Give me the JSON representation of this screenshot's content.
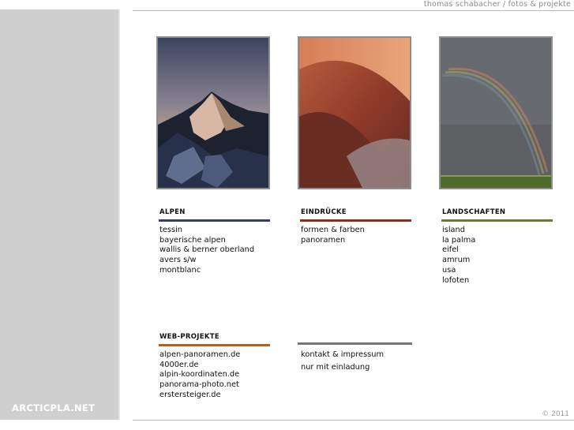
{
  "header": {
    "tagline": "thomas schabacher / fotos & projekte"
  },
  "footer": {
    "copyright": "© 2011"
  },
  "sidebar": {
    "brand": "ARCTICPLA.NET"
  },
  "sections": {
    "alpen": {
      "title": "ALPEN",
      "color": "#3a3f5a",
      "items": [
        "tessin",
        "bayerische alpen",
        "wallis & berner oberland",
        "avers s/w",
        "montblanc"
      ]
    },
    "eindruecke": {
      "title": "EINDRÜCKE",
      "color": "#8a2f20",
      "items": [
        "formen & farben",
        "panoramen"
      ]
    },
    "landschaften": {
      "title": "LANDSCHAFTEN",
      "color": "#6b7a3a",
      "items": [
        "island",
        "la palma",
        "eifel",
        "amrum",
        "usa",
        "lofoten"
      ]
    },
    "webprojekte": {
      "title": "WEB-PROJEKTE",
      "color": "#b0641e",
      "items": [
        "alpen-panoramen.de",
        "4000er.de",
        "alpin-koordinaten.de",
        "panorama-photo.net",
        "erstersteiger.de"
      ]
    },
    "contact": {
      "items": [
        "kontakt & impressum",
        "nur mit einladung"
      ]
    }
  },
  "photos": {
    "alpen": "alpine-peak-photo",
    "eindruecke": "red-rock-texture-photo",
    "landschaften": "rainbow-landscape-photo"
  }
}
